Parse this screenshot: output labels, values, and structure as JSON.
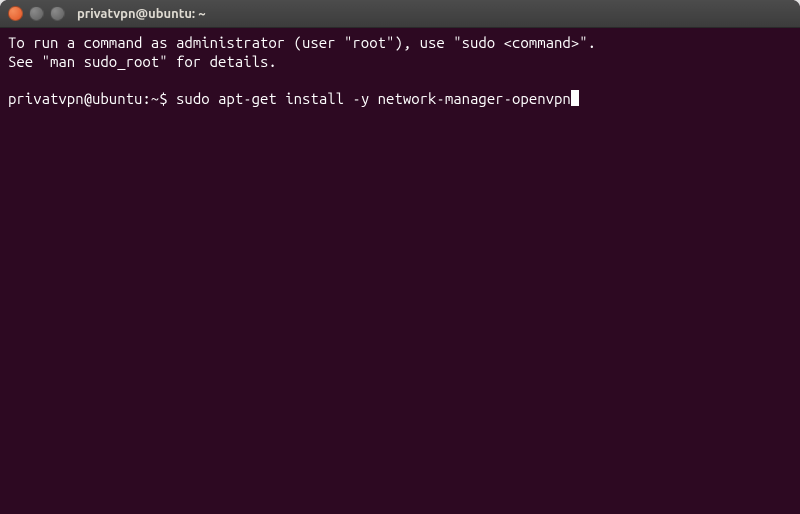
{
  "window": {
    "title": "privatvpn@ubuntu: ~"
  },
  "terminal": {
    "motd_line1": "To run a command as administrator (user \"root\"), use \"sudo <command>\".",
    "motd_line2": "See \"man sudo_root\" for details.",
    "prompt": "privatvpn@ubuntu:~$ ",
    "command": "sudo apt-get install -y network-manager-openvpn"
  }
}
